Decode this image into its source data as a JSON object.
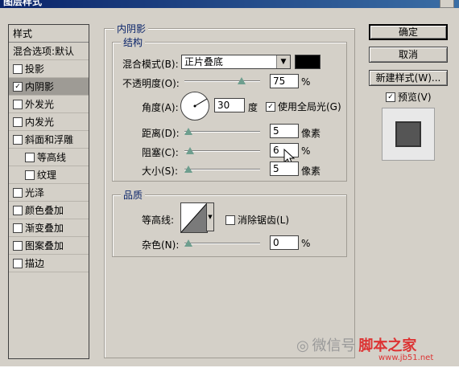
{
  "window": {
    "title": "图层样式"
  },
  "left_panel": {
    "header": "样式",
    "items": [
      {
        "label": "混合选项:默认",
        "checkbox": false
      },
      {
        "label": "投影",
        "checkbox": true,
        "checked": false
      },
      {
        "label": "内阴影",
        "checkbox": true,
        "checked": true,
        "selected": true
      },
      {
        "label": "外发光",
        "checkbox": true,
        "checked": false
      },
      {
        "label": "内发光",
        "checkbox": true,
        "checked": false
      },
      {
        "label": "斜面和浮雕",
        "checkbox": true,
        "checked": false
      },
      {
        "label": "等高线",
        "checkbox": true,
        "checked": false,
        "indent": true
      },
      {
        "label": "纹理",
        "checkbox": true,
        "checked": false,
        "indent": true
      },
      {
        "label": "光泽",
        "checkbox": true,
        "checked": false
      },
      {
        "label": "颜色叠加",
        "checkbox": true,
        "checked": false
      },
      {
        "label": "渐变叠加",
        "checkbox": true,
        "checked": false
      },
      {
        "label": "图案叠加",
        "checkbox": true,
        "checked": false
      },
      {
        "label": "描边",
        "checkbox": true,
        "checked": false
      }
    ]
  },
  "inner_shadow": {
    "title": "内阴影",
    "structure": {
      "title": "结构",
      "blend_mode_label": "混合模式(B):",
      "blend_mode_value": "正片叠底",
      "color": "#000000",
      "opacity_label": "不透明度(O):",
      "opacity_value": "75",
      "opacity_unit": "%",
      "opacity_fraction": 0.75,
      "angle_label": "角度(A):",
      "angle_value": "30",
      "angle_unit": "度",
      "global_light_label": "使用全局光(G)",
      "global_light_checked": true,
      "distance_label": "距离(D):",
      "distance_value": "5",
      "distance_unit": "像素",
      "choke_label": "阻塞(C):",
      "choke_value": "6",
      "choke_unit": "%",
      "size_label": "大小(S):",
      "size_value": "5",
      "size_unit": "像素"
    },
    "quality": {
      "title": "品质",
      "contour_label": "等高线:",
      "antialias_label": "消除锯齿(L)",
      "antialias_checked": false,
      "noise_label": "杂色(N):",
      "noise_value": "0",
      "noise_unit": "%"
    }
  },
  "buttons": {
    "ok": "确定",
    "cancel": "取消",
    "new_style": "新建样式(W)...",
    "preview_label": "预览(V)",
    "preview_checked": true
  },
  "watermark": {
    "wechat": "微信号",
    "site": "脚本之家",
    "url": "www.jb51.net"
  }
}
